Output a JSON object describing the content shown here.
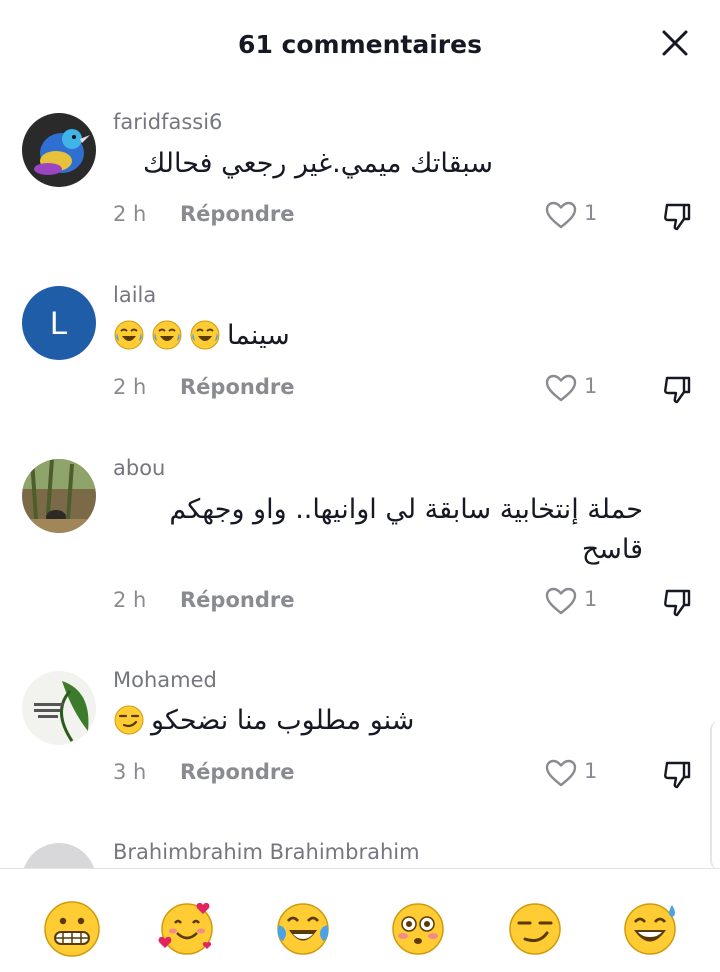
{
  "header": {
    "title": "61 commentaires"
  },
  "comments": [
    {
      "username": "faridfassi6",
      "text": "سبقاتك ميمي.غير رجعي فحالك",
      "time": "2 h",
      "reply": "Répondre",
      "likes": "1"
    },
    {
      "username": "laila",
      "avatar_letter": "L",
      "text": "سينما",
      "time": "2 h",
      "reply": "Répondre",
      "likes": "1"
    },
    {
      "username": "abou",
      "text": "حملة إنتخابية سابقة لي اوانيها.. واو وجهكم قاسح",
      "time": "2 h",
      "reply": "Répondre",
      "likes": "1"
    },
    {
      "username": "Mohamed",
      "text": "شنو مطلوب منا نضحكو",
      "time": "3 h",
      "reply": "Répondre",
      "likes": "1"
    },
    {
      "username": "Brahimbrahim Brahimbrahim"
    }
  ],
  "emoji_bar": [
    "grimacing-face",
    "smiling-face-with-hearts",
    "face-with-tears-of-joy",
    "flushed-face",
    "smirking-face",
    "grinning-sweat-face"
  ],
  "colors": {
    "avatar_laila": "#1f5da8",
    "emoji_yellow": "#ffcc33"
  }
}
